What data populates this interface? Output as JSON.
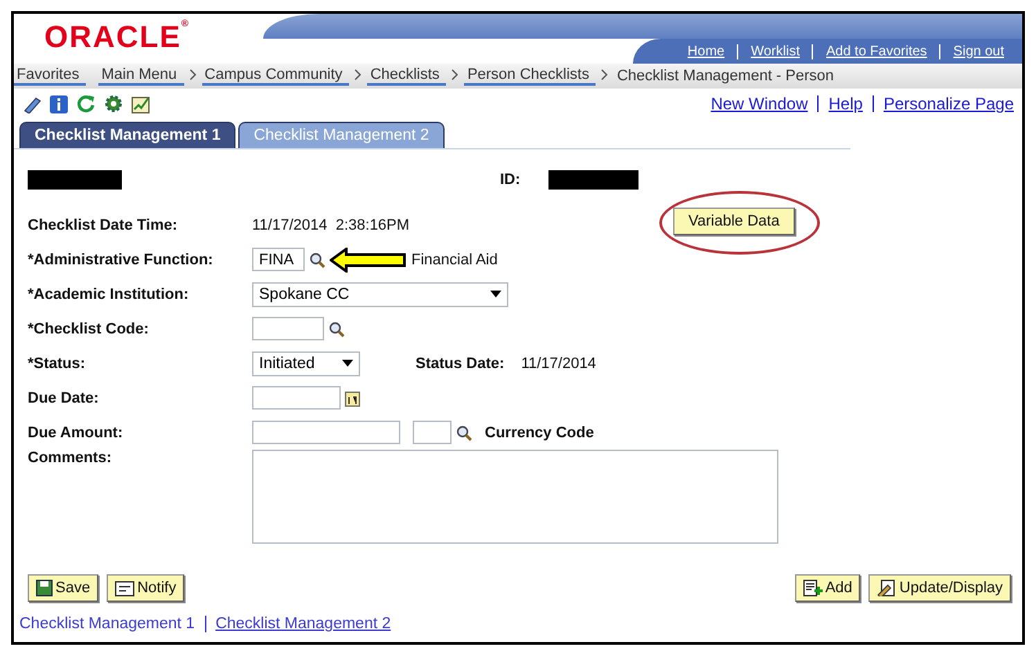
{
  "logo": "ORACLE$^{®}$",
  "header_links": [
    "Home",
    "Worklist",
    "Add to Favorites",
    "Sign out"
  ],
  "breadcrumbs": [
    {
      "label": "Favorites",
      "menu": true
    },
    {
      "label": "Main Menu",
      "menu": true
    },
    {
      "label": "Campus Community",
      "menu": true
    },
    {
      "label": "Checklists",
      "menu": true
    },
    {
      "label": "Person Checklists",
      "menu": true
    },
    {
      "label": "Checklist Management - Person",
      "menu": false
    }
  ],
  "toolbar_links": [
    "New Window",
    "Help",
    "Personalize Page"
  ],
  "tabs": [
    {
      "label": "Checklist Management 1",
      "selected": true
    },
    {
      "label": "Checklist Management 2",
      "selected": false
    }
  ],
  "id_label": "ID:",
  "variable_data": {
    "label": "Variable Data",
    "circled": true
  },
  "fields": [
    {
      "kind": "static",
      "label": "Checklist Date Time:",
      "value": "11/17/2014  2:38:16PM"
    },
    {
      "kind": "lookup",
      "label": "*Administrative Function:",
      "value": "FINA",
      "description": "Financial Aid",
      "pointer": true
    },
    {
      "kind": "select",
      "label": "*Academic Institution:",
      "value": "Spokane CC"
    },
    {
      "kind": "lookup",
      "label": "*Checklist Code:",
      "pointer": false
    },
    {
      "kind": "status",
      "label": "*Status:",
      "value": "Initiated",
      "date_label": "Status Date:",
      "date_value": "11/17/2014"
    },
    {
      "kind": "date",
      "label": "Due Date:"
    },
    {
      "kind": "amount",
      "label": "Due Amount:",
      "currency_label": "Currency Code"
    },
    {
      "kind": "textarea",
      "label": "Comments:"
    }
  ],
  "left_buttons": [
    {
      "label": "Save"
    },
    {
      "label": "Notify"
    }
  ],
  "right_buttons": [
    {
      "label": "Add"
    },
    {
      "label": "Update/Display"
    }
  ],
  "footer_links": [
    {
      "label": "Checklist Management 1",
      "underlined": false
    },
    {
      "label": "Checklist Management 2",
      "underlined": true
    }
  ]
}
